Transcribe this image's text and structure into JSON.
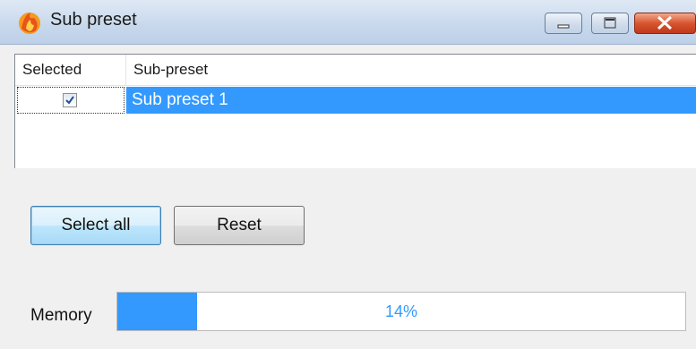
{
  "window": {
    "title": "Sub preset",
    "icon": "app-flame-icon"
  },
  "list": {
    "columns": [
      "Selected",
      "Sub-preset"
    ],
    "rows": [
      {
        "selected": true,
        "name": "Sub preset 1"
      }
    ],
    "selection_color": "#3399ff"
  },
  "buttons": {
    "select_all": "Select all",
    "reset": "Reset"
  },
  "memory": {
    "label": "Memory",
    "percent": 14,
    "text": "14%",
    "bar_color": "#3399ff"
  }
}
